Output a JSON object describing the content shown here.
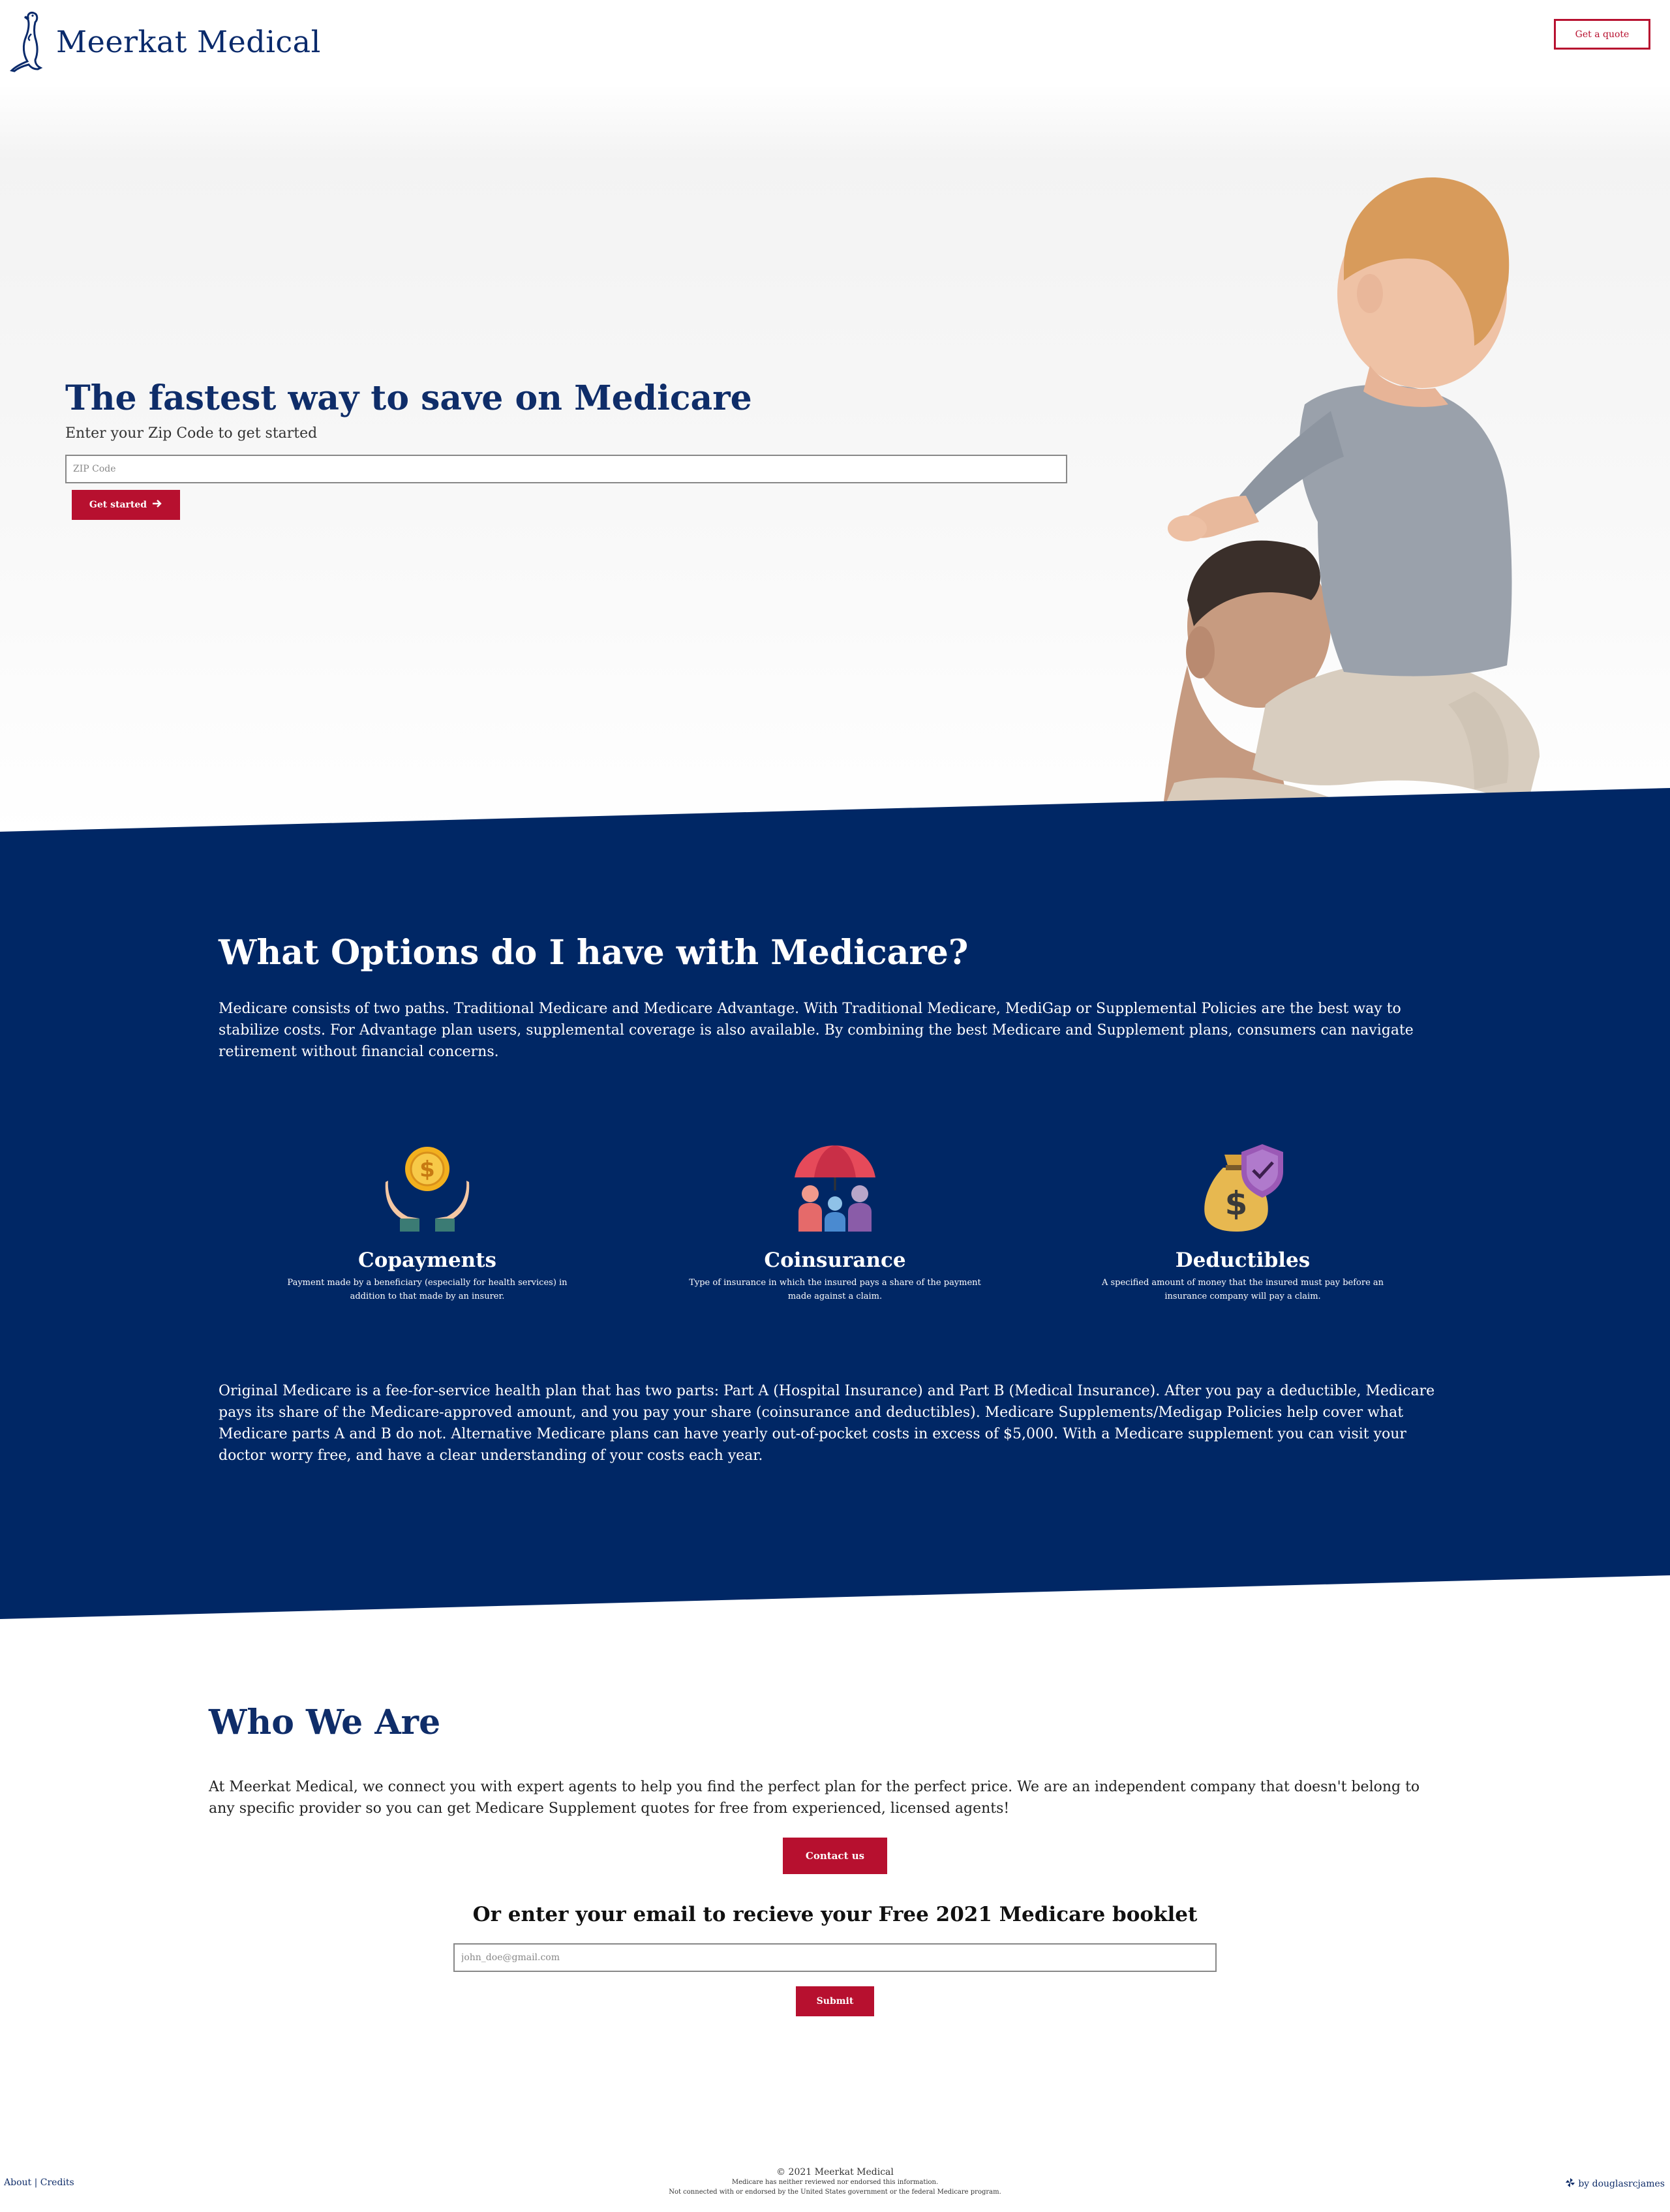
{
  "colors": {
    "brand_navy": "#0f2d69",
    "section_blue": "#002765",
    "accent_red": "#b7102f"
  },
  "header": {
    "brand_name": "Meerkat Medical",
    "quote_button": "Get a quote",
    "logo_icon": "meerkat-icon"
  },
  "hero": {
    "title": "The fastest way to save on Medicare",
    "subtitle": "Enter your Zip Code to get started",
    "zip_placeholder": "ZIP Code",
    "zip_value": "",
    "start_button": "Get started",
    "start_icon": "arrow-right-icon"
  },
  "options": {
    "title": "What Options do I have with Medicare?",
    "text": "Medicare consists of two paths. Traditional Medicare and Medicare Advantage. With Traditional Medicare, MediGap or Supplemental Policies are the best way to stabilize costs. For Advantage plan users, supplemental coverage is also available. By combining the best Medicare and Supplement plans, consumers can navigate retirement without financial concerns.",
    "features": [
      {
        "icon": "coin-hands-icon",
        "title": "Copayments",
        "desc": "Payment made by a beneficiary (especially for health services) in addition to that made by an insurer."
      },
      {
        "icon": "family-umbrella-icon",
        "title": "Coinsurance",
        "desc": "Type of insurance in which the insured pays a share of the payment made against a claim."
      },
      {
        "icon": "money-bag-shield-icon",
        "title": "Deductibles",
        "desc": "A specified amount of money that the insured must pay before an insurance company will pay a claim."
      }
    ],
    "original_text": "Original Medicare is a fee-for-service health plan that has two parts: Part A (Hospital Insurance) and Part B (Medical Insurance). After you pay a deductible, Medicare pays its share of the Medicare-approved amount, and you pay your share (coinsurance and deductibles). Medicare Supplements/Medigap Policies help cover what Medicare parts A and B do not. Alternative Medicare plans can have yearly out-of-pocket costs in excess of $5,000. With a Medicare supplement you can visit your doctor worry free, and have a clear understanding of your costs each year."
  },
  "who": {
    "title": "Who We Are",
    "text": "At Meerkat Medical, we connect you with expert agents to help you find the perfect plan for the perfect price. We are an independent company that doesn't belong to any specific provider so you can get Medicare Supplement quotes for free from experienced, licensed agents!",
    "contact_button": "Contact us",
    "booklet_title": "Or enter your email to recieve your Free 2021 Medicare booklet",
    "email_placeholder": "john_doe@gmail.com",
    "submit_button": "Submit"
  },
  "footer": {
    "about": "About",
    "separator": "|",
    "credits": "Credits",
    "copyright": "© 2021 Meerkat Medical",
    "note1": "Medicare has neither reviewed nor endorsed this information.",
    "note2": "Not connected with or endorsed by the United States government or the federal Medicare program.",
    "author": "by douglasrcjames",
    "author_icon": "pinwheel-icon"
  }
}
